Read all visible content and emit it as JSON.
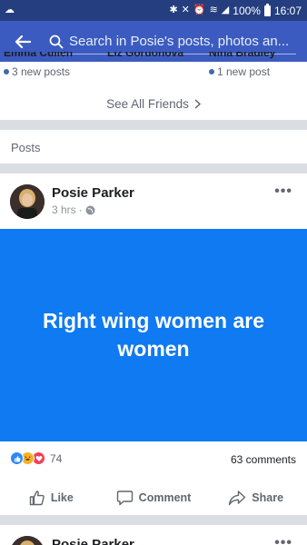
{
  "status_bar": {
    "battery": "100%",
    "time": "16:07"
  },
  "search": {
    "placeholder": "Search in Posie's posts, photos an..."
  },
  "friends": [
    {
      "name": "Emma Cullen",
      "count": "3 new posts"
    },
    {
      "name": "Liz Gordonova",
      "count": ""
    },
    {
      "name": "Nina Bradley",
      "count": "1 new post"
    }
  ],
  "see_all": "See All Friends",
  "posts_header": "Posts",
  "post": {
    "author": "Posie Parker",
    "time": "3 hrs",
    "body": "Right wing women are women",
    "background": "#0f7af2",
    "reaction_count": "74",
    "reactions": [
      "like",
      "haha",
      "love"
    ],
    "comments": "63 comments",
    "actions": {
      "like": "Like",
      "comment": "Comment",
      "share": "Share"
    }
  },
  "next_post": {
    "author": "Posie Parker"
  }
}
